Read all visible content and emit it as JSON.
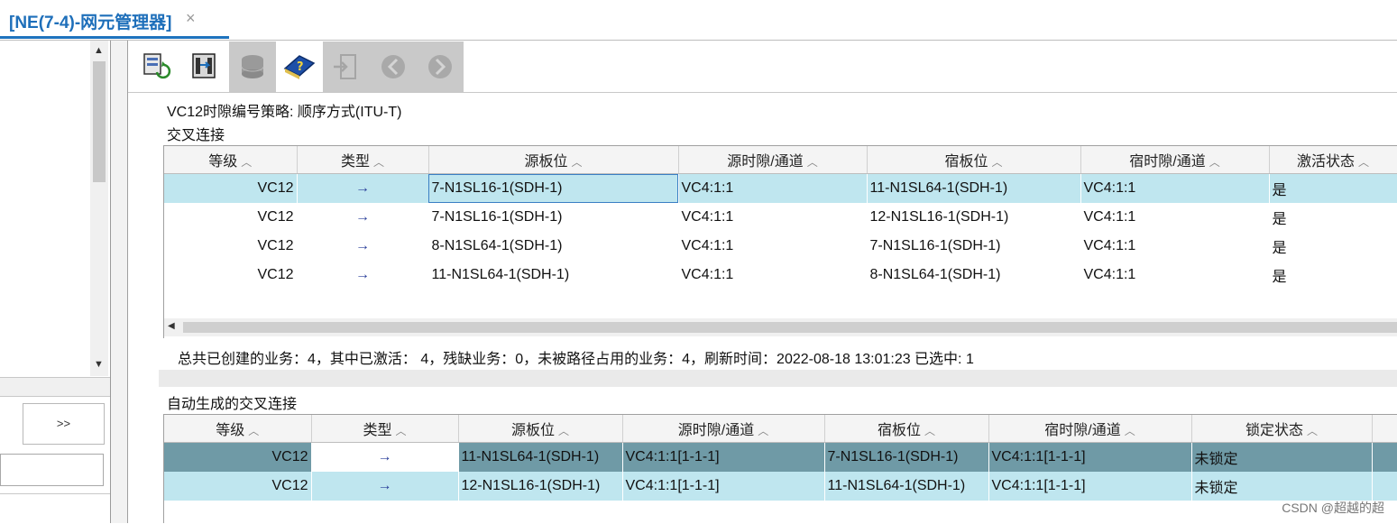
{
  "window": {
    "tab_title": "[NE(7-4)-网元管理器]",
    "close_glyph": "×"
  },
  "left": {
    "go_button": ">>"
  },
  "toolbar": {
    "buttons": [
      {
        "icon": "refresh-ne-icon",
        "enabled": true
      },
      {
        "icon": "swap-board-icon",
        "enabled": true
      },
      {
        "icon": "database-icon",
        "enabled": false
      },
      {
        "icon": "help-book-icon",
        "enabled": true
      },
      {
        "icon": "exit-icon",
        "enabled": false
      },
      {
        "icon": "back-icon",
        "enabled": false
      },
      {
        "icon": "forward-icon",
        "enabled": false
      }
    ]
  },
  "strategy_label": "VC12时隙编号策略: 顺序方式(ITU-T)",
  "cross_section_label": "交叉连接",
  "cross": {
    "headers": [
      "等级",
      "类型",
      "源板位",
      "源时隙/通道",
      "宿板位",
      "宿时隙/通道",
      "激活状态"
    ],
    "sort_glyph": "︿",
    "rows": [
      {
        "level": "VC12",
        "type": "→",
        "src_board": "7-N1SL16-1(SDH-1)",
        "src_slot": "VC4:1:1",
        "dst_board": "11-N1SL64-1(SDH-1)",
        "dst_slot": "VC4:1:1",
        "active": "是"
      },
      {
        "level": "VC12",
        "type": "→",
        "src_board": "7-N1SL16-1(SDH-1)",
        "src_slot": "VC4:1:1",
        "dst_board": "12-N1SL16-1(SDH-1)",
        "dst_slot": "VC4:1:1",
        "active": "是"
      },
      {
        "level": "VC12",
        "type": "→",
        "src_board": "8-N1SL64-1(SDH-1)",
        "src_slot": "VC4:1:1",
        "dst_board": "7-N1SL16-1(SDH-1)",
        "dst_slot": "VC4:1:1",
        "active": "是"
      },
      {
        "level": "VC12",
        "type": "→",
        "src_board": "11-N1SL64-1(SDH-1)",
        "src_slot": "VC4:1:1",
        "dst_board": "8-N1SL64-1(SDH-1)",
        "dst_slot": "VC4:1:1",
        "active": "是"
      }
    ]
  },
  "summary": "总共已创建的业务：4，其中已激活： 4，残缺业务：0，未被路径占用的业务：4，刷新时间：2022-08-18 13:01:23    已选中: 1",
  "auto_section_label": "自动生成的交叉连接",
  "auto": {
    "headers": [
      "等级",
      "类型",
      "源板位",
      "源时隙/通道",
      "宿板位",
      "宿时隙/通道",
      "锁定状态"
    ],
    "rows": [
      {
        "level": "VC12",
        "type": "→",
        "src_board": "11-N1SL64-1(SDH-1)",
        "src_slot": "VC4:1:1[1-1-1]",
        "dst_board": "7-N1SL16-1(SDH-1)",
        "dst_slot": "VC4:1:1[1-1-1]",
        "lock": "未锁定"
      },
      {
        "level": "VC12",
        "type": "→",
        "src_board": "12-N1SL16-1(SDH-1)",
        "src_slot": "VC4:1:1[1-1-1]",
        "dst_board": "11-N1SL64-1(SDH-1)",
        "dst_slot": "VC4:1:1[1-1-1]",
        "lock": "未锁定"
      }
    ]
  },
  "watermark": "CSDN @超越的超",
  "colors": {
    "accent": "#1e6fba",
    "selected_row": "#bfe6ef",
    "focused_row": "#6f9aa6",
    "arrow": "#2a3f9a"
  }
}
